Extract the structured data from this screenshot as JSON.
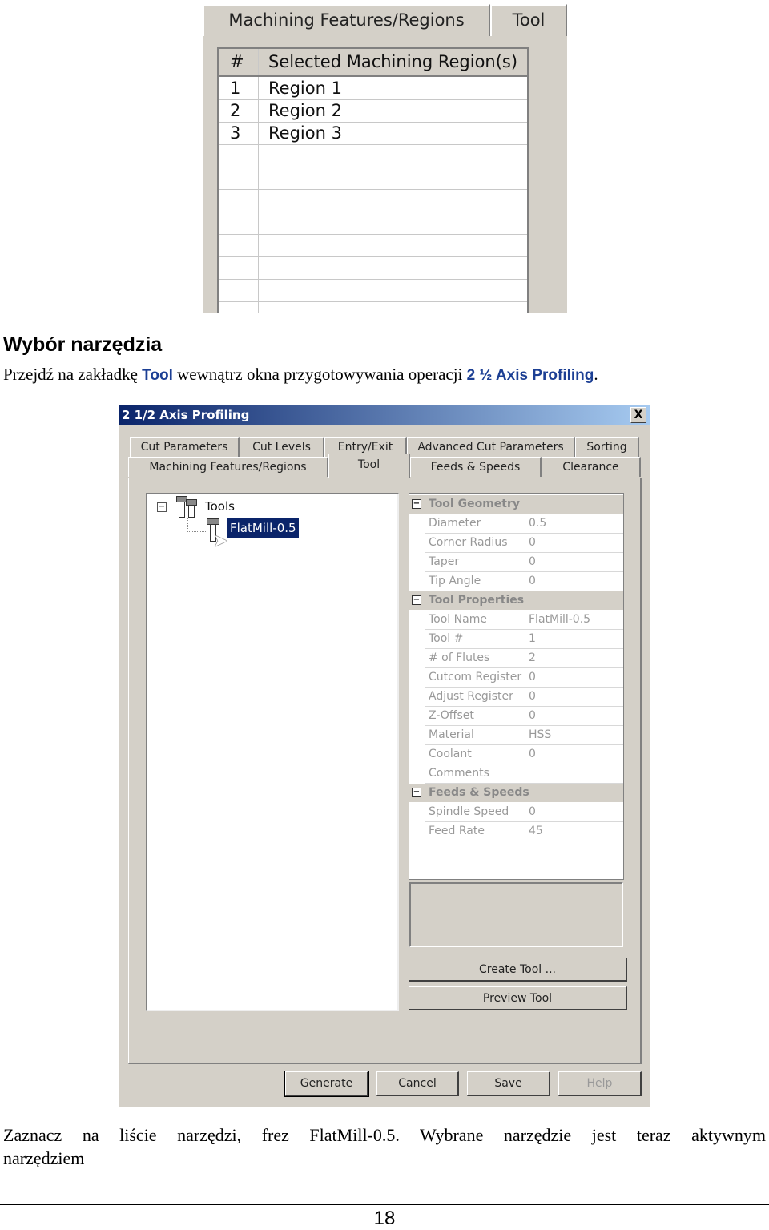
{
  "top_screenshot": {
    "tabs": [
      "Machining Features/Regions",
      "Tool"
    ],
    "table": {
      "headers": [
        "#",
        "Selected Machining Region(s)"
      ],
      "rows": [
        [
          "1",
          "Region 1"
        ],
        [
          "2",
          "Region 2"
        ],
        [
          "3",
          "Region 3"
        ]
      ]
    }
  },
  "heading": "Wybór narzędzia",
  "paragraph": {
    "pre": "Przejdź na zakładkę ",
    "tool": "Tool",
    "mid": " wewnątrz okna przygotowywania operacji ",
    "op": "2 ½ Axis Profiling",
    "post": "."
  },
  "dialog": {
    "title": "2 1/2 Axis Profiling",
    "close": "X",
    "tabs_row1": [
      "Cut Parameters",
      "Cut Levels",
      "Entry/Exit",
      "Advanced Cut Parameters",
      "Sorting"
    ],
    "tabs_row2": [
      "Machining Features/Regions",
      "Tool",
      "Feeds & Speeds",
      "Clearance"
    ],
    "active_tab": "Tool",
    "tree": {
      "root": "Tools",
      "child": "FlatMill-0.5"
    },
    "grid": [
      {
        "category": "Tool Geometry",
        "rows": [
          [
            "Diameter",
            "0.5"
          ],
          [
            "Corner Radius",
            "0"
          ],
          [
            "Taper",
            "0"
          ],
          [
            "Tip Angle",
            "0"
          ]
        ]
      },
      {
        "category": "Tool Properties",
        "rows": [
          [
            "Tool Name",
            "FlatMill-0.5"
          ],
          [
            "Tool #",
            "1"
          ],
          [
            "# of Flutes",
            "2"
          ],
          [
            "Cutcom Register",
            "0"
          ],
          [
            "Adjust Register",
            "0"
          ],
          [
            "Z-Offset",
            "0"
          ],
          [
            "Material",
            "HSS"
          ],
          [
            "Coolant",
            "0"
          ],
          [
            "Comments",
            ""
          ]
        ]
      },
      {
        "category": "Feeds & Speeds",
        "rows": [
          [
            "Spindle Speed",
            "0"
          ],
          [
            "Feed Rate",
            "45"
          ]
        ]
      }
    ],
    "create_tool": "Create Tool ...",
    "preview_tool": "Preview Tool",
    "buttons": [
      "Generate",
      "Cancel",
      "Save",
      "Help"
    ]
  },
  "bottom_text": {
    "line1": "Zaznacz na liście narzędzi, frez FlatMill-0.5. Wybrane narzędzie jest teraz aktywnym",
    "line2": "narzędziem"
  },
  "page_number": "18",
  "colors": {
    "accent": "#1c3f94",
    "selection": "#0a246a",
    "dialog_bg": "#d4d0c8"
  }
}
